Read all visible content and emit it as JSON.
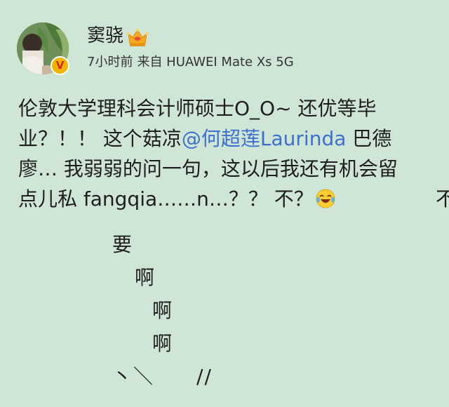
{
  "post": {
    "username": "窦骁",
    "time": "7小时前",
    "source": "来自 HUAWEI Mate Xs 5G",
    "badge_letter": "V",
    "icons": {
      "crown": "crown-icon",
      "verified": "verified-badge-icon",
      "laugh": "laughing-tears-emoji-icon"
    },
    "colors": {
      "background": "#cfe6d6",
      "mention": "#3c6fd0",
      "badge": "#f0b400"
    },
    "content": {
      "line1": "伦敦大学理科会计师硕士O_O~ 还优等毕",
      "line2_pre": "业？！！ 这个菇凉",
      "mention": "@何超莲Laurinda",
      "line2_post": " 巴德",
      "line3": "廖… 我弱弱的问一句，这以后我还有机会留",
      "line4": "点儿私 fangqia……n…？？ 不？",
      "bu": "不",
      "yao": "要",
      "a1": "啊",
      "a2": "啊",
      "a3": "啊",
      "strokes_left": "丶＼",
      "strokes_right": "//"
    }
  }
}
